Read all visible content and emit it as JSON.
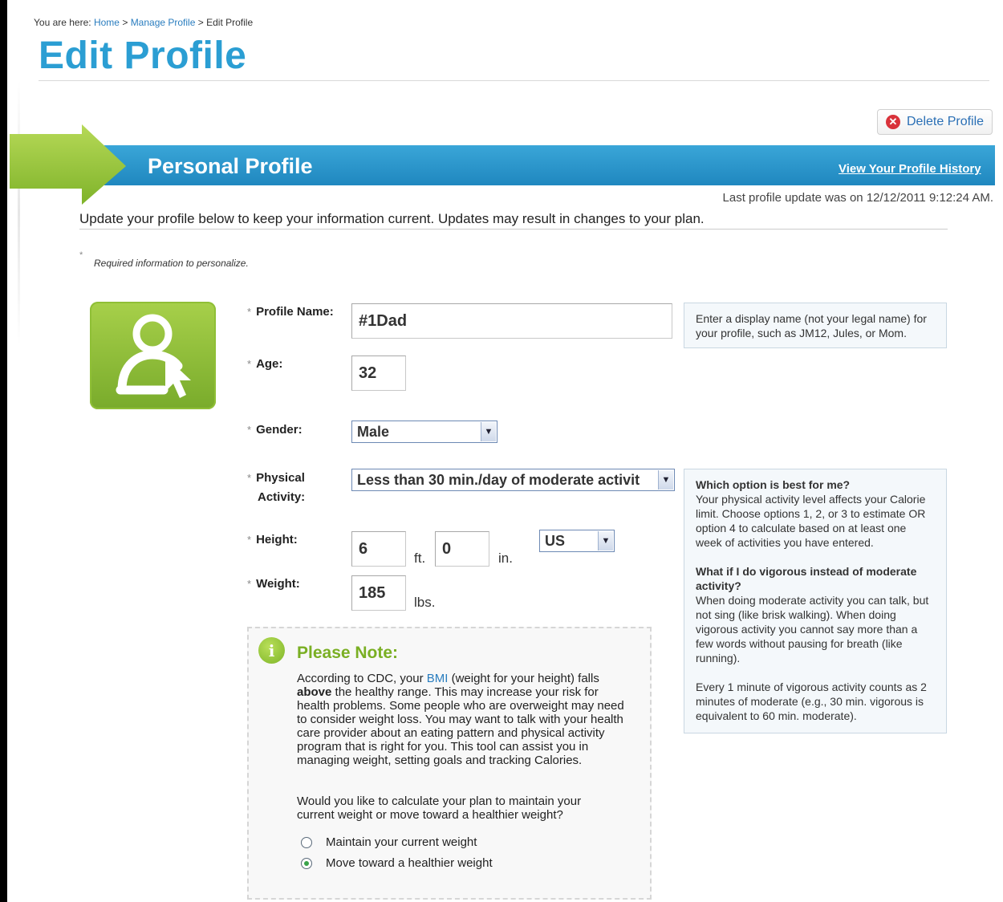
{
  "breadcrumb": {
    "prefix": "You are here:",
    "home": "Home",
    "sep1": ">",
    "manage": "Manage Profile",
    "sep2": ">",
    "current": "Edit Profile"
  },
  "page_title": "Edit Profile",
  "delete_button": "Delete Profile",
  "banner": {
    "title": "Personal Profile",
    "history_link": "View Your Profile History"
  },
  "last_update": "Last profile update was on 12/12/2011 9:12:24 AM.",
  "intro": "Update your profile below to keep your information current. Updates may result in changes to your plan.",
  "required": {
    "star": "*",
    "note": "Required information to personalize."
  },
  "form": {
    "profile_name": {
      "label": "Profile Name:",
      "value": "#1Dad"
    },
    "age": {
      "label": "Age:",
      "value": "32"
    },
    "gender": {
      "label": "Gender:",
      "value": "Male"
    },
    "activity": {
      "label_1": "Physical",
      "label_2": "Activity:",
      "value": "Less than 30 min./day of moderate activit"
    },
    "height": {
      "label": "Height:",
      "ft_value": "6",
      "ft_unit": "ft.",
      "in_value": "0",
      "in_unit": "in.",
      "system": "US"
    },
    "weight": {
      "label": "Weight:",
      "value": "185",
      "unit": "lbs."
    }
  },
  "tips": {
    "name_tip": "Enter a display name (not your legal name) for your profile, such as JM12, Jules, or Mom.",
    "activity_q1": "Which option is best for me?",
    "activity_a1": "Your physical activity level affects your Calorie limit. Choose options 1, 2, or 3 to estimate OR option 4 to calculate based on at least one week of activities you have entered.",
    "activity_q2": "What if I do vigorous instead of moderate activity?",
    "activity_a2": "When doing moderate activity you can talk, but not sing (like brisk walking). When doing vigorous activity you cannot say more than a few words without pausing for breath (like running).",
    "activity_a3": "Every 1 minute of vigorous activity counts as 2 minutes of moderate (e.g., 30 min. vigorous is equivalent to 60 min. moderate)."
  },
  "note": {
    "icon": "i",
    "title": "Please Note:",
    "text_1": "According to CDC, your",
    "bmi_link": "BMI",
    "text_2": "(weight for your height) falls",
    "above": "above",
    "text_3": "the healthy range. This may increase your risk for health problems. Some people who are overweight may need to consider weight loss. You may want to talk with your health care provider about an eating pattern and physical activity program that is right for you. This tool can assist you in managing weight, setting goals and tracking Calories.",
    "question": "Would you like to calculate your plan to maintain your current weight or move toward a healthier weight?",
    "option_maintain": "Maintain your current weight",
    "option_move": "Move toward a healthier weight",
    "selected": "Move toward a healthier weight"
  },
  "colors": {
    "title_blue": "#2b9ed3",
    "banner_blue": "#2591c9",
    "green": "#8cbf34",
    "delete_red": "#d9323a"
  }
}
